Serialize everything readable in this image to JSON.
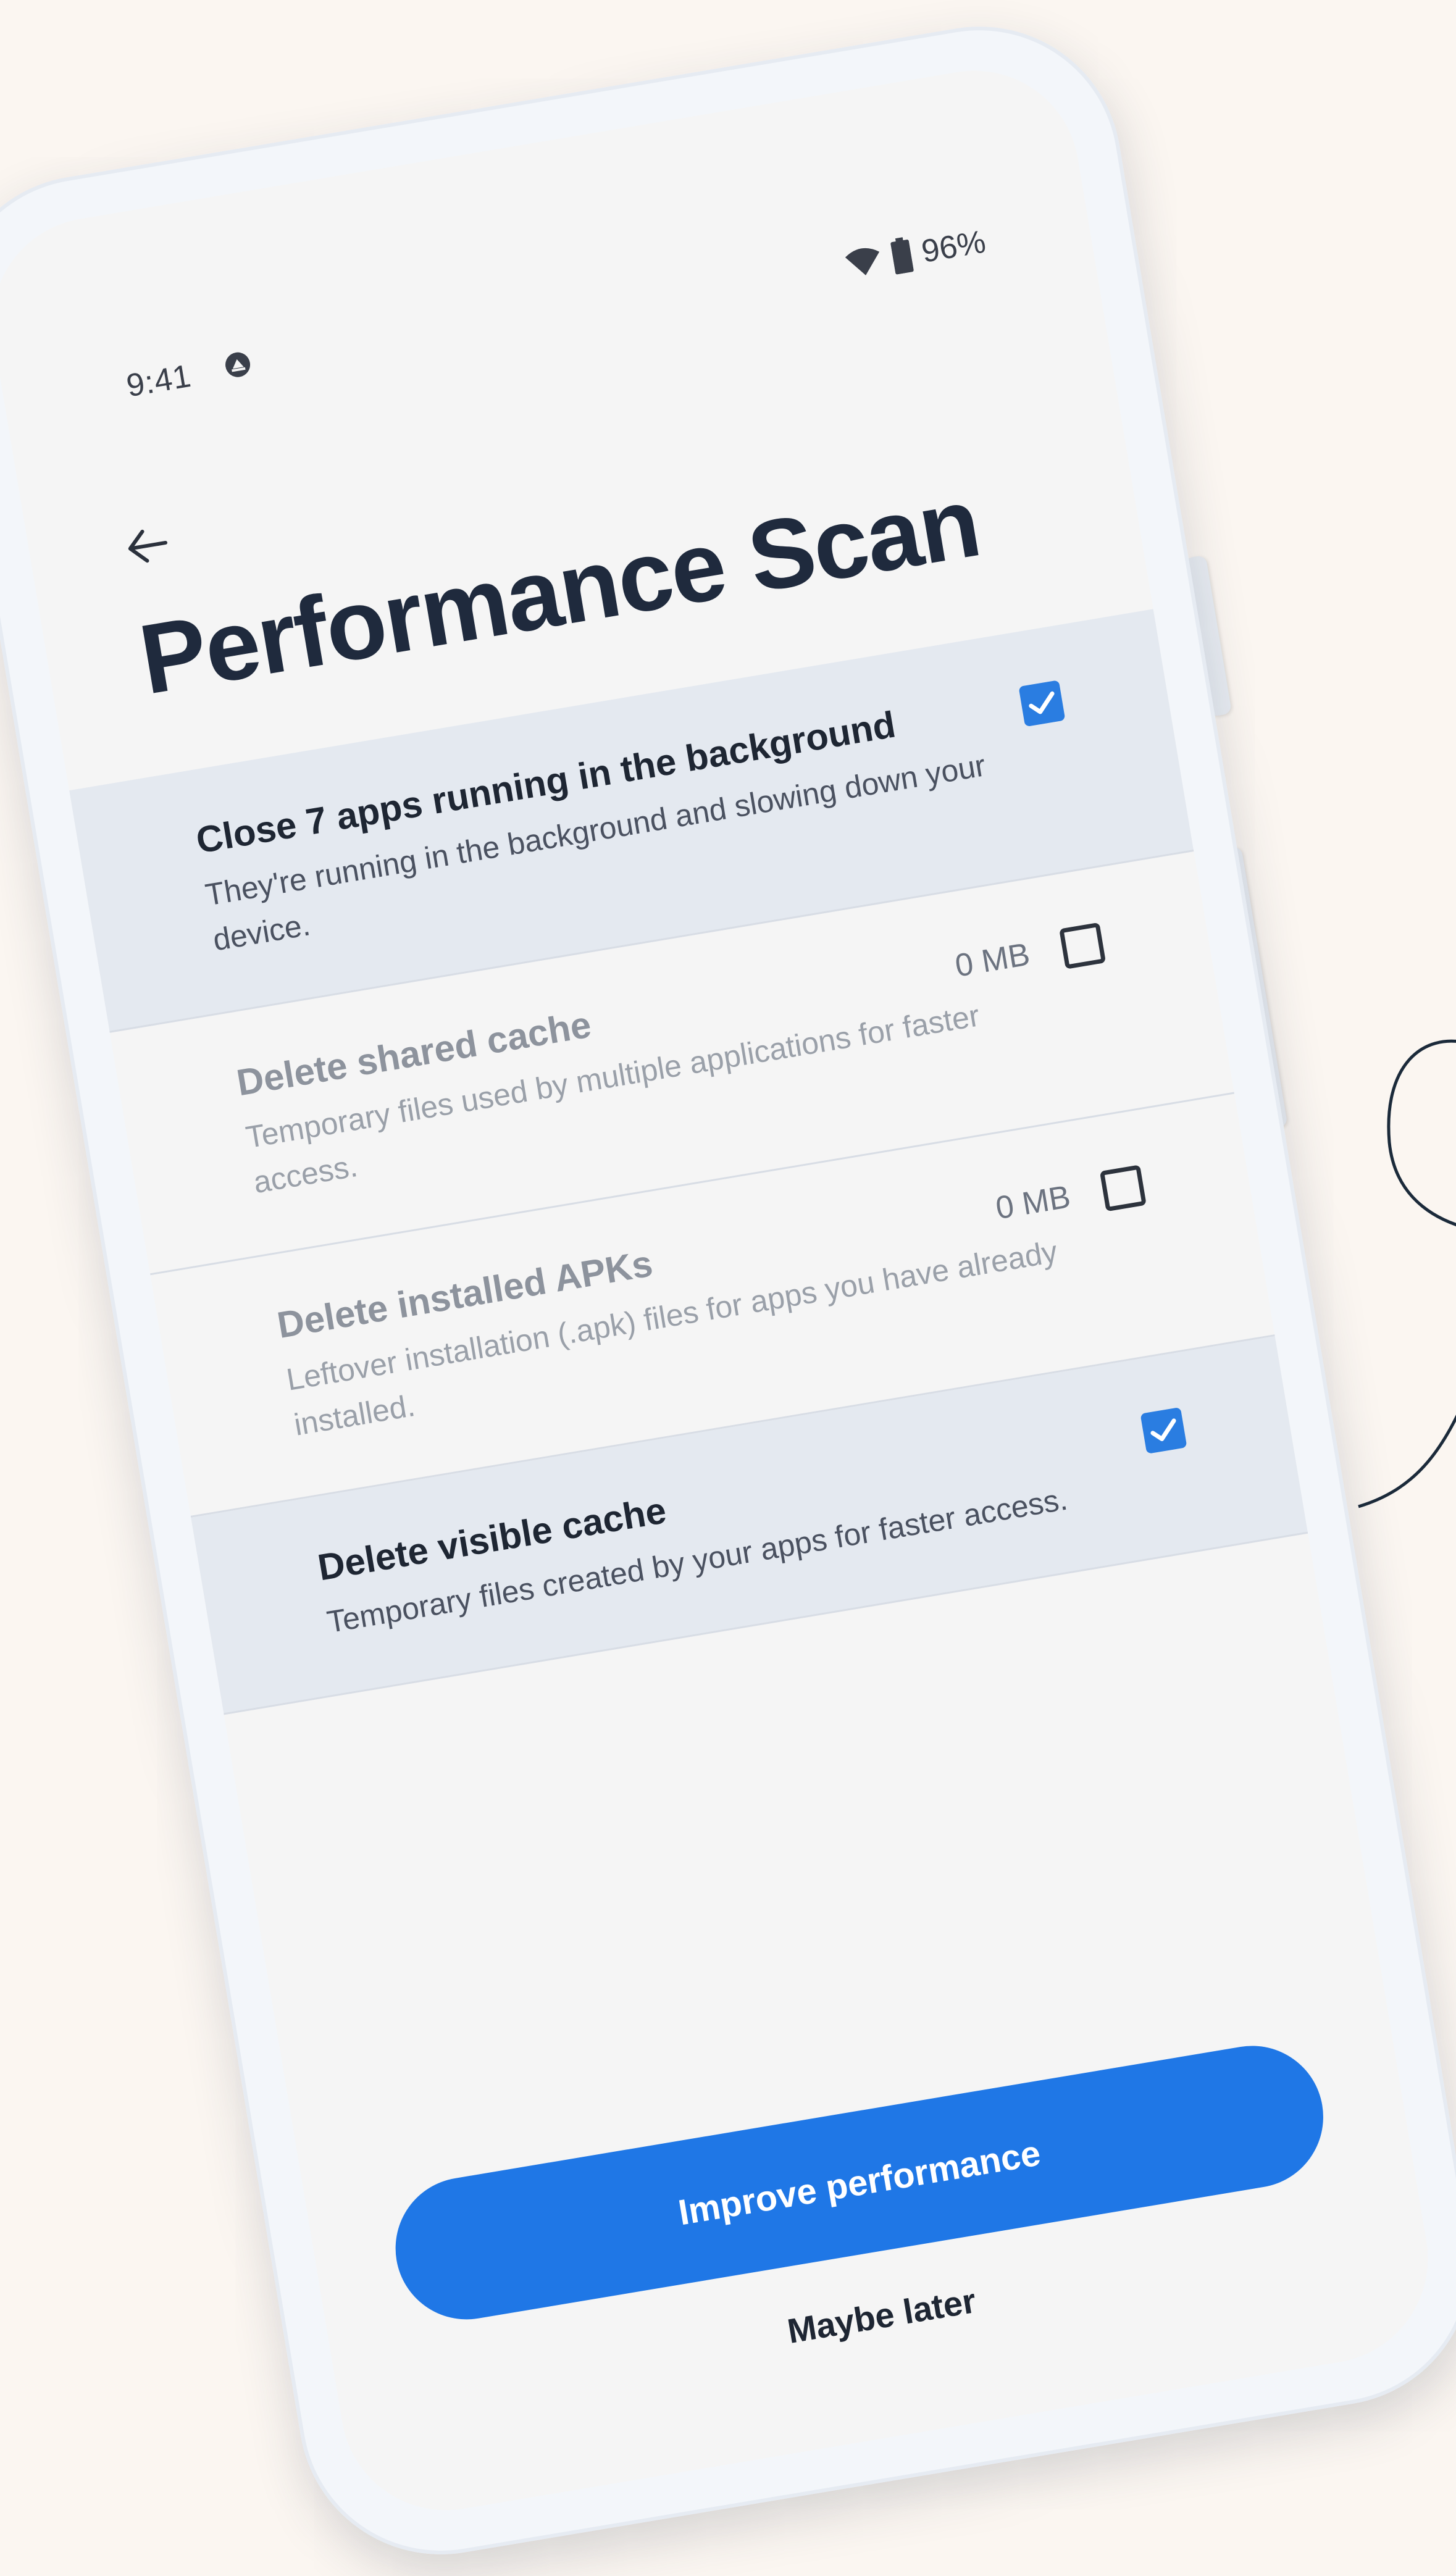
{
  "status_bar": {
    "time": "9:41",
    "battery_percent": "96%",
    "icons": [
      "do-not-disturb-icon",
      "wifi-icon",
      "battery-icon"
    ]
  },
  "header": {
    "back_icon": "back-arrow-icon",
    "title": "Performance Scan"
  },
  "items": [
    {
      "title": "Close 7 apps running in the background",
      "description": "They're running in the background and slowing down your device.",
      "size": "",
      "checked": true,
      "enabled": true
    },
    {
      "title": "Delete shared cache",
      "description": "Temporary files used by multiple applications for faster access.",
      "size": "0 MB",
      "checked": false,
      "enabled": false
    },
    {
      "title": "Delete installed APKs",
      "description": "Leftover installation (.apk) files for apps you have already installed.",
      "size": "0 MB",
      "checked": false,
      "enabled": false
    },
    {
      "title": "Delete visible cache",
      "description": "Temporary files created by your apps for faster access.",
      "size": "",
      "checked": true,
      "enabled": true
    }
  ],
  "actions": {
    "primary_label": "Improve performance",
    "secondary_label": "Maybe later"
  },
  "colors": {
    "accent": "#1f77e6",
    "checkbox_checked": "#2a7de1",
    "selected_row": "#e4e9f0",
    "background": "#fbf6f1"
  }
}
